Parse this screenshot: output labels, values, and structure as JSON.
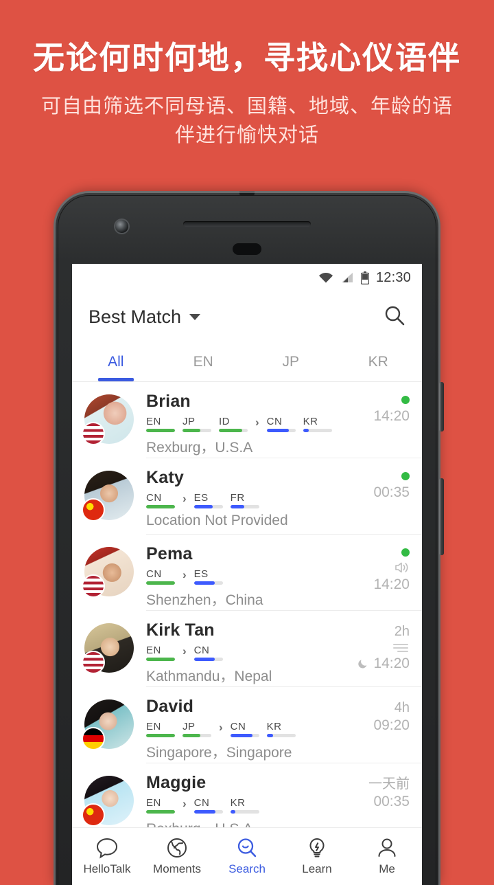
{
  "promo": {
    "title": "无论何时何地，寻找心仪语伴",
    "subtitle": "可自由筛选不同母语、国籍、地域、年龄的语伴进行愉快对话",
    "background_color": "#de5244",
    "title_color": "#ffffff",
    "subtitle_color": "#ffe2dd"
  },
  "statusbar": {
    "time": "12:30",
    "wifi_icon": "wifi-icon",
    "signal_icon": "cellular-signal-icon",
    "battery_icon": "battery-icon"
  },
  "appbar": {
    "title": "Best Match",
    "dropdown_icon": "chevron-down-icon",
    "search_icon": "search-icon"
  },
  "tabs": [
    {
      "label": "All",
      "active": true
    },
    {
      "label": "EN",
      "active": false
    },
    {
      "label": "JP",
      "active": false
    },
    {
      "label": "KR",
      "active": false
    }
  ],
  "colors": {
    "accent_blue": "#3b5be0",
    "native_green": "#4cb64c",
    "learning_blue": "#3d5afe",
    "online_green": "#33bb44",
    "muted_text": "#8d8d8d"
  },
  "users": [
    {
      "name": "Brian",
      "native": [
        {
          "code": "EN",
          "level": 100
        },
        {
          "code": "JP",
          "level": 62
        },
        {
          "code": "ID",
          "level": 80
        }
      ],
      "learning": [
        {
          "code": "CN",
          "level": 76
        },
        {
          "code": "KR",
          "level": 20
        }
      ],
      "location": "Rexburg，U.S.A",
      "flag": "us-flag",
      "online": true,
      "ago": "",
      "time": "14:20",
      "extra_icon": ""
    },
    {
      "name": "Katy",
      "native": [
        {
          "code": "CN",
          "level": 100
        }
      ],
      "learning": [
        {
          "code": "ES",
          "level": 66
        },
        {
          "code": "FR",
          "level": 48
        }
      ],
      "location": "Location Not Provided",
      "flag": "cn-flag",
      "online": true,
      "ago": "",
      "time": "00:35",
      "extra_icon": ""
    },
    {
      "name": "Pema",
      "native": [
        {
          "code": "CN",
          "level": 100
        }
      ],
      "learning": [
        {
          "code": "ES",
          "level": 72
        }
      ],
      "location": "Shenzhen，China",
      "flag": "us-flag",
      "online": true,
      "ago": "",
      "time": "14:20",
      "extra_icon": "speaker-icon"
    },
    {
      "name": "Kirk Tan",
      "native": [
        {
          "code": "EN",
          "level": 100
        }
      ],
      "learning": [
        {
          "code": "CN",
          "level": 72
        }
      ],
      "location": "Kathmandu，Nepal",
      "flag": "us-flag",
      "online": false,
      "ago": "2h",
      "time": "14:20",
      "extra_icon": "text-lines-icon",
      "time_prefix_icon": "moon-icon"
    },
    {
      "name": "David",
      "native": [
        {
          "code": "EN",
          "level": 100
        },
        {
          "code": "JP",
          "level": 62
        }
      ],
      "learning": [
        {
          "code": "CN",
          "level": 78
        },
        {
          "code": "KR",
          "level": 22
        }
      ],
      "location": "Singapore，Singapore",
      "flag": "de-flag",
      "online": false,
      "ago": "4h",
      "time": "09:20",
      "extra_icon": ""
    },
    {
      "name": "Maggie",
      "native": [
        {
          "code": "EN",
          "level": 100
        }
      ],
      "learning": [
        {
          "code": "CN",
          "level": 74
        },
        {
          "code": "KR",
          "level": 18
        }
      ],
      "location": "Rexburg，U.S.A",
      "flag": "cn-flag",
      "online": false,
      "ago": "一天前",
      "time": "00:35",
      "extra_icon": ""
    }
  ],
  "bottomnav": [
    {
      "label": "HelloTalk",
      "icon": "chat-bubble-icon",
      "active": false
    },
    {
      "label": "Moments",
      "icon": "globe-icon",
      "active": false
    },
    {
      "label": "Search",
      "icon": "search-smiley-icon",
      "active": true
    },
    {
      "label": "Learn",
      "icon": "lightbulb-icon",
      "active": false
    },
    {
      "label": "Me",
      "icon": "person-icon",
      "active": false
    }
  ]
}
